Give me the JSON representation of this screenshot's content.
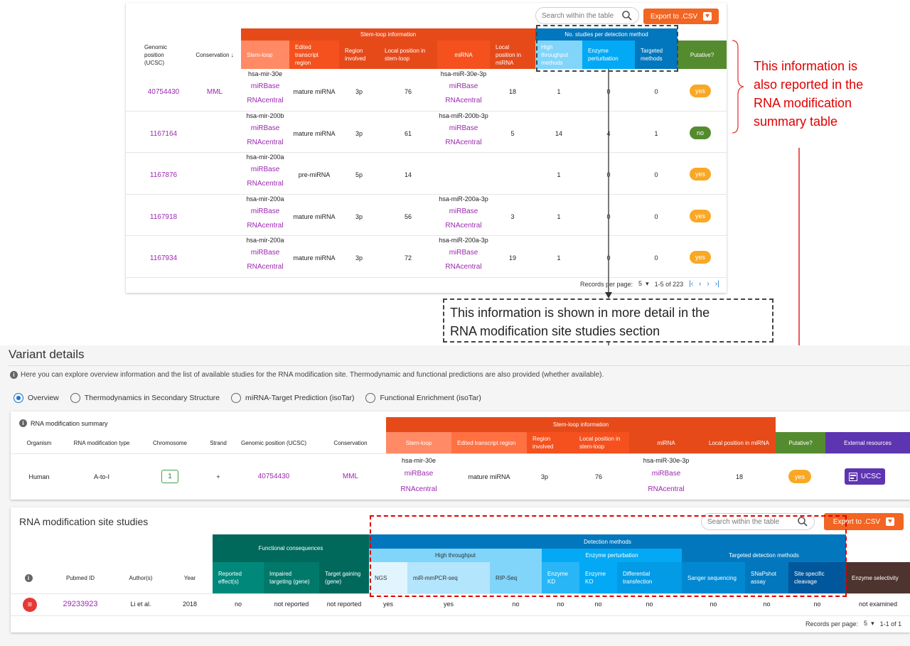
{
  "top_table": {
    "search_placeholder": "Search within the table",
    "export_label": "Export to .CSV",
    "group_stemloop": "Stem-loop information",
    "group_studies": "No. studies per detection method",
    "headers": {
      "genomic": "Genomic position (UCSC)",
      "conservation": "Conservation",
      "stemloop": "Stem-loop",
      "edited": "Edited transcript region",
      "region": "Region involved",
      "localpos": "Local position in stem-loop",
      "mirna": "miRNA",
      "localmirna": "Local position in miRNA",
      "ht": "High throughput methods",
      "enzyme": "Enzyme perturbation",
      "targeted": "Targeted methods",
      "putative": "Putative?"
    },
    "rows": [
      {
        "pos": "40754430",
        "cons": "MML",
        "stemloop": "hsa-mir-30e",
        "db1": "miRBase",
        "db2": "RNAcentral",
        "edited": "mature miRNA",
        "region": "3p",
        "localpos": "76",
        "mirna": "hsa-miR-30e-3p",
        "mdb1": "miRBase",
        "mdb2": "RNAcentral",
        "localmirna": "18",
        "ht": "1",
        "enzyme": "0",
        "targeted": "0",
        "putative": "yes"
      },
      {
        "pos": "1167164",
        "cons": "",
        "stemloop": "hsa-mir-200b",
        "db1": "miRBase",
        "db2": "RNAcentral",
        "edited": "mature miRNA",
        "region": "3p",
        "localpos": "61",
        "mirna": "hsa-miR-200b-3p",
        "mdb1": "miRBase",
        "mdb2": "RNAcentral",
        "localmirna": "5",
        "ht": "14",
        "enzyme": "4",
        "targeted": "1",
        "putative": "no"
      },
      {
        "pos": "1167876",
        "cons": "",
        "stemloop": "hsa-mir-200a",
        "db1": "miRBase",
        "db2": "RNAcentral",
        "edited": "pre-miRNA",
        "region": "5p",
        "localpos": "14",
        "mirna": "",
        "mdb1": "",
        "mdb2": "",
        "localmirna": "",
        "ht": "1",
        "enzyme": "0",
        "targeted": "0",
        "putative": "yes"
      },
      {
        "pos": "1167918",
        "cons": "",
        "stemloop": "hsa-mir-200a",
        "db1": "miRBase",
        "db2": "RNAcentral",
        "edited": "mature miRNA",
        "region": "3p",
        "localpos": "56",
        "mirna": "hsa-miR-200a-3p",
        "mdb1": "miRBase",
        "mdb2": "RNAcentral",
        "localmirna": "3",
        "ht": "1",
        "enzyme": "0",
        "targeted": "0",
        "putative": "yes"
      },
      {
        "pos": "1167934",
        "cons": "",
        "stemloop": "hsa-mir-200a",
        "db1": "miRBase",
        "db2": "RNAcentral",
        "edited": "mature miRNA",
        "region": "3p",
        "localpos": "72",
        "mirna": "hsa-miR-200a-3p",
        "mdb1": "miRBase",
        "mdb2": "RNAcentral",
        "localmirna": "19",
        "ht": "1",
        "enzyme": "0",
        "targeted": "0",
        "putative": "yes"
      }
    ],
    "pager": {
      "label": "Records per page:",
      "value": "5",
      "range": "1-5 of 223"
    }
  },
  "annotations": {
    "right": [
      "This information is",
      "also reported in the",
      "RNA modification",
      "summary  table"
    ],
    "middle": [
      "This information is shown in more detail in the",
      "RNA modification site studies section"
    ]
  },
  "variant": {
    "title": "Variant details",
    "info": "Here you can explore overview information and the list of available studies for the RNA modification site. Thermodynamic and functional predictions are also provided (whether available).",
    "tabs": [
      "Overview",
      "Thermodynamics in Secondary Structure",
      "miRNA-Target Prediction (isoTar)",
      "Functional Enrichment (isoTar)"
    ]
  },
  "summary": {
    "title": "RNA modification summary",
    "group_stemloop": "Stem-loop information",
    "headers": {
      "organism": "Organism",
      "type": "RNA modification type",
      "chromosome": "Chromosome",
      "strand": "Strand",
      "genomic": "Genomic position (UCSC)",
      "conservation": "Conservation",
      "stemloop": "Stem-loop",
      "edited": "Edited transcript region",
      "region": "Region involved",
      "localpos": "Local position in stem-loop",
      "mirna": "miRNA",
      "localmirna": "Local position in miRNA",
      "putative": "Putative?",
      "external": "External resources"
    },
    "row": {
      "organism": "Human",
      "type": "A-to-I",
      "chromosome": "1",
      "strand": "+",
      "pos": "40754430",
      "cons": "MML",
      "stemloop": "hsa-mir-30e",
      "db1": "miRBase",
      "db2": "RNAcentral",
      "edited": "mature miRNA",
      "region": "3p",
      "localpos": "76",
      "mirna": "hsa-miR-30e-3p",
      "mdb1": "miRBase",
      "mdb2": "RNAcentral",
      "localmirna": "18",
      "putative": "yes",
      "ucsc": "UCSC"
    }
  },
  "studies": {
    "title": "RNA modification site studies",
    "search_placeholder": "Search within the table",
    "export_label": "Export to .CSV",
    "group_functional": "Functional consequences",
    "group_detection": "Detection methods",
    "sub_ht": "High throughput",
    "sub_enzyme": "Enzyme perturbation",
    "sub_targeted": "Targeted detection methods",
    "headers": {
      "pubmed": "Pubmed ID",
      "authors": "Author(s)",
      "year": "Year",
      "reported": "Reported effect(s)",
      "impaired": "Impaired targeting (gene)",
      "gaining": "Target gaining (gene)",
      "ngs": "NGS",
      "mmpcr": "miR-mmPCR-seq",
      "rip": "RIP-Seq",
      "kd": "Enzyme KD",
      "ko": "Enzyme KO",
      "diff": "Differential transfection",
      "sanger": "Sanger sequencing",
      "snapshot": "SNaPshot assay",
      "cleavage": "Site specific cleavage",
      "selectivity": "Enzyme selectivity"
    },
    "row": {
      "pubmed": "29233923",
      "authors": "Li et al.",
      "year": "2018",
      "reported": "no",
      "impaired": "not reported",
      "gaining": "not reported",
      "ngs": "yes",
      "mmpcr": "yes",
      "rip": "no",
      "kd": "no",
      "ko": "no",
      "diff": "no",
      "sanger": "no",
      "snapshot": "no",
      "cleavage": "no",
      "selectivity": "not examined"
    },
    "pager": {
      "label": "Records per page:",
      "value": "5",
      "range": "1-1 of 1"
    }
  },
  "colors": {
    "stemloop_dark": "#e64a19",
    "stemloop_light": "#ff8a65",
    "studies_blue": "#0277bd",
    "putative_green": "#558b2f",
    "external_purple": "#5e35b1",
    "functional_green": "#00695c",
    "yes_pill": "#f9a825",
    "no_pill": "#558b2f",
    "export_orange": "#f26522"
  }
}
